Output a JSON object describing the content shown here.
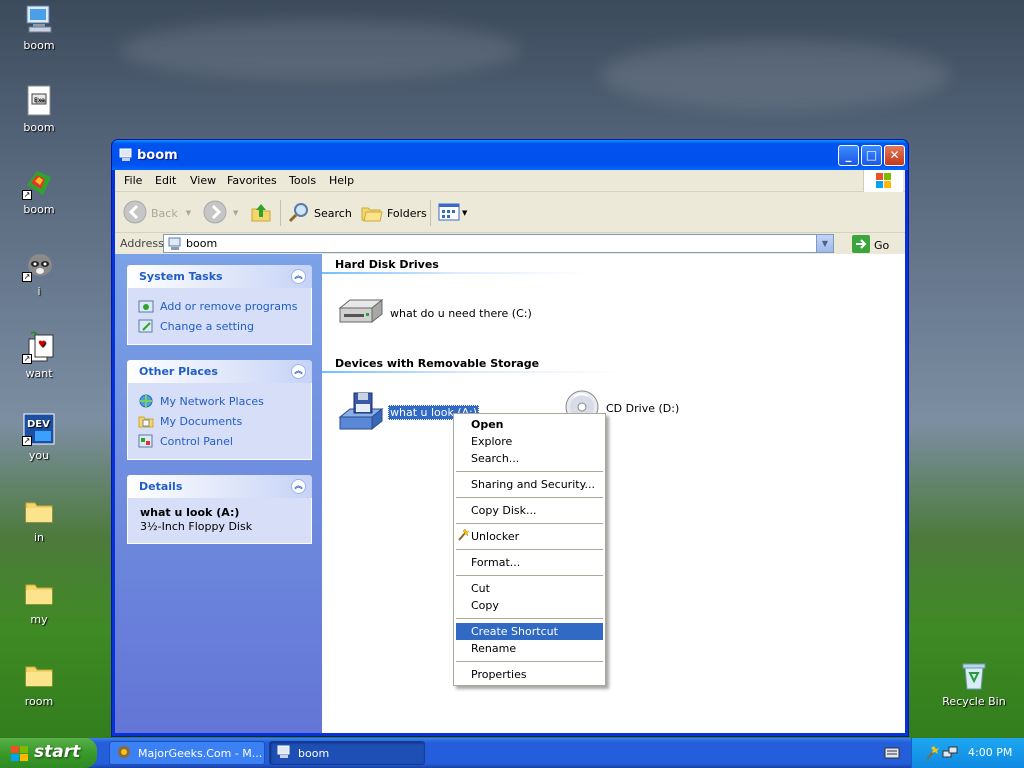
{
  "desktop": {
    "icons": [
      {
        "label": "boom",
        "icon": "computer-icon"
      },
      {
        "label": "boom",
        "icon": "exe-file-icon"
      },
      {
        "label": "boom",
        "icon": "app-shortcut-icon"
      },
      {
        "label": "i",
        "icon": "raccoon-shortcut-icon"
      },
      {
        "label": "want",
        "icon": "cards-shortcut-icon"
      },
      {
        "label": "you",
        "icon": "dev-cpp-shortcut-icon"
      },
      {
        "label": "in",
        "icon": "folder-icon"
      },
      {
        "label": "my",
        "icon": "folder-icon"
      },
      {
        "label": "room",
        "icon": "folder-icon"
      }
    ],
    "recycle_bin": "Recycle Bin"
  },
  "window": {
    "title": "boom",
    "menu": [
      "File",
      "Edit",
      "View",
      "Favorites",
      "Tools",
      "Help"
    ],
    "toolbar": {
      "back": "Back",
      "search": "Search",
      "folders": "Folders"
    },
    "address": {
      "label": "Address",
      "value": "boom",
      "go": "Go"
    }
  },
  "taskpane": {
    "system_tasks": {
      "title": "System Tasks",
      "items": [
        "Add or remove programs",
        "Change a setting"
      ]
    },
    "other_places": {
      "title": "Other Places",
      "items": [
        "My Network Places",
        "My Documents",
        "Control Panel"
      ]
    },
    "details": {
      "title": "Details",
      "name": "what u look (A:)",
      "type": "3½-Inch Floppy Disk"
    }
  },
  "content": {
    "hard_disk_header": "Hard Disk Drives",
    "drive_c": "what do u need there (C:)",
    "removable_header": "Devices with Removable Storage",
    "drive_a": "what u look (A:)",
    "drive_d": "CD Drive (D:)"
  },
  "context_menu": {
    "open": "Open",
    "explore": "Explore",
    "search": "Search...",
    "sharing": "Sharing and Security...",
    "copy_disk": "Copy Disk...",
    "unlocker": "Unlocker",
    "format": "Format...",
    "cut": "Cut",
    "copy": "Copy",
    "create_shortcut": "Create Shortcut",
    "rename": "Rename",
    "properties": "Properties"
  },
  "taskbar": {
    "start": "start",
    "tasks": [
      "MajorGeeks.Com - M...",
      "boom"
    ],
    "clock": "4:00 PM"
  }
}
